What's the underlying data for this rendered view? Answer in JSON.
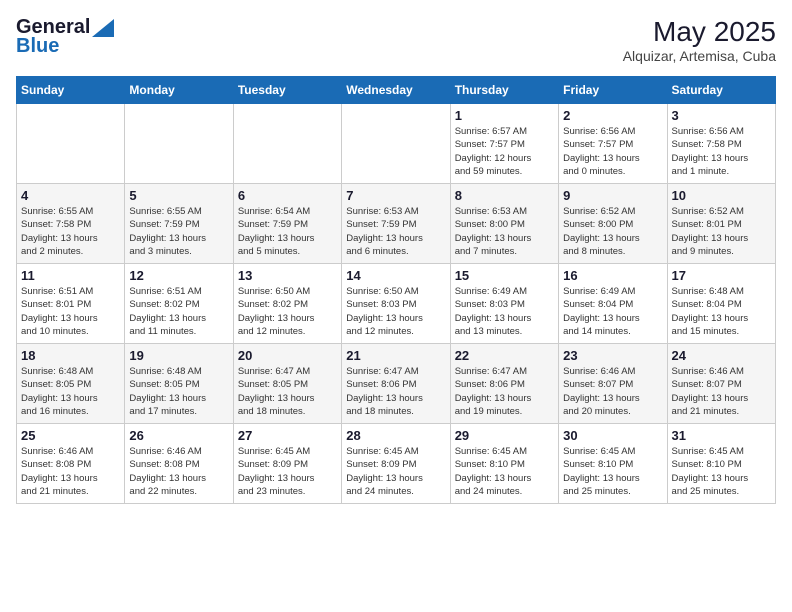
{
  "logo": {
    "general": "General",
    "blue": "Blue"
  },
  "title": "May 2025",
  "subtitle": "Alquizar, Artemisa, Cuba",
  "weekdays": [
    "Sunday",
    "Monday",
    "Tuesday",
    "Wednesday",
    "Thursday",
    "Friday",
    "Saturday"
  ],
  "days": [
    {
      "date": null,
      "number": "",
      "sunrise": "",
      "sunset": "",
      "daylight": ""
    },
    {
      "date": null,
      "number": "",
      "sunrise": "",
      "sunset": "",
      "daylight": ""
    },
    {
      "date": null,
      "number": "",
      "sunrise": "",
      "sunset": "",
      "daylight": ""
    },
    {
      "date": null,
      "number": "",
      "sunrise": "",
      "sunset": "",
      "daylight": ""
    },
    {
      "date": "1",
      "number": "1",
      "sunrise": "6:57 AM",
      "sunset": "7:57 PM",
      "daylight": "12 hours and 59 minutes."
    },
    {
      "date": "2",
      "number": "2",
      "sunrise": "6:56 AM",
      "sunset": "7:57 PM",
      "daylight": "13 hours and 0 minutes."
    },
    {
      "date": "3",
      "number": "3",
      "sunrise": "6:56 AM",
      "sunset": "7:58 PM",
      "daylight": "13 hours and 1 minute."
    },
    {
      "date": "4",
      "number": "4",
      "sunrise": "6:55 AM",
      "sunset": "7:58 PM",
      "daylight": "13 hours and 2 minutes."
    },
    {
      "date": "5",
      "number": "5",
      "sunrise": "6:55 AM",
      "sunset": "7:59 PM",
      "daylight": "13 hours and 3 minutes."
    },
    {
      "date": "6",
      "number": "6",
      "sunrise": "6:54 AM",
      "sunset": "7:59 PM",
      "daylight": "13 hours and 5 minutes."
    },
    {
      "date": "7",
      "number": "7",
      "sunrise": "6:53 AM",
      "sunset": "7:59 PM",
      "daylight": "13 hours and 6 minutes."
    },
    {
      "date": "8",
      "number": "8",
      "sunrise": "6:53 AM",
      "sunset": "8:00 PM",
      "daylight": "13 hours and 7 minutes."
    },
    {
      "date": "9",
      "number": "9",
      "sunrise": "6:52 AM",
      "sunset": "8:00 PM",
      "daylight": "13 hours and 8 minutes."
    },
    {
      "date": "10",
      "number": "10",
      "sunrise": "6:52 AM",
      "sunset": "8:01 PM",
      "daylight": "13 hours and 9 minutes."
    },
    {
      "date": "11",
      "number": "11",
      "sunrise": "6:51 AM",
      "sunset": "8:01 PM",
      "daylight": "13 hours and 10 minutes."
    },
    {
      "date": "12",
      "number": "12",
      "sunrise": "6:51 AM",
      "sunset": "8:02 PM",
      "daylight": "13 hours and 11 minutes."
    },
    {
      "date": "13",
      "number": "13",
      "sunrise": "6:50 AM",
      "sunset": "8:02 PM",
      "daylight": "13 hours and 12 minutes."
    },
    {
      "date": "14",
      "number": "14",
      "sunrise": "6:50 AM",
      "sunset": "8:03 PM",
      "daylight": "13 hours and 12 minutes."
    },
    {
      "date": "15",
      "number": "15",
      "sunrise": "6:49 AM",
      "sunset": "8:03 PM",
      "daylight": "13 hours and 13 minutes."
    },
    {
      "date": "16",
      "number": "16",
      "sunrise": "6:49 AM",
      "sunset": "8:04 PM",
      "daylight": "13 hours and 14 minutes."
    },
    {
      "date": "17",
      "number": "17",
      "sunrise": "6:48 AM",
      "sunset": "8:04 PM",
      "daylight": "13 hours and 15 minutes."
    },
    {
      "date": "18",
      "number": "18",
      "sunrise": "6:48 AM",
      "sunset": "8:05 PM",
      "daylight": "13 hours and 16 minutes."
    },
    {
      "date": "19",
      "number": "19",
      "sunrise": "6:48 AM",
      "sunset": "8:05 PM",
      "daylight": "13 hours and 17 minutes."
    },
    {
      "date": "20",
      "number": "20",
      "sunrise": "6:47 AM",
      "sunset": "8:05 PM",
      "daylight": "13 hours and 18 minutes."
    },
    {
      "date": "21",
      "number": "21",
      "sunrise": "6:47 AM",
      "sunset": "8:06 PM",
      "daylight": "13 hours and 18 minutes."
    },
    {
      "date": "22",
      "number": "22",
      "sunrise": "6:47 AM",
      "sunset": "8:06 PM",
      "daylight": "13 hours and 19 minutes."
    },
    {
      "date": "23",
      "number": "23",
      "sunrise": "6:46 AM",
      "sunset": "8:07 PM",
      "daylight": "13 hours and 20 minutes."
    },
    {
      "date": "24",
      "number": "24",
      "sunrise": "6:46 AM",
      "sunset": "8:07 PM",
      "daylight": "13 hours and 21 minutes."
    },
    {
      "date": "25",
      "number": "25",
      "sunrise": "6:46 AM",
      "sunset": "8:08 PM",
      "daylight": "13 hours and 21 minutes."
    },
    {
      "date": "26",
      "number": "26",
      "sunrise": "6:46 AM",
      "sunset": "8:08 PM",
      "daylight": "13 hours and 22 minutes."
    },
    {
      "date": "27",
      "number": "27",
      "sunrise": "6:45 AM",
      "sunset": "8:09 PM",
      "daylight": "13 hours and 23 minutes."
    },
    {
      "date": "28",
      "number": "28",
      "sunrise": "6:45 AM",
      "sunset": "8:09 PM",
      "daylight": "13 hours and 24 minutes."
    },
    {
      "date": "29",
      "number": "29",
      "sunrise": "6:45 AM",
      "sunset": "8:10 PM",
      "daylight": "13 hours and 24 minutes."
    },
    {
      "date": "30",
      "number": "30",
      "sunrise": "6:45 AM",
      "sunset": "8:10 PM",
      "daylight": "13 hours and 25 minutes."
    },
    {
      "date": "31",
      "number": "31",
      "sunrise": "6:45 AM",
      "sunset": "8:10 PM",
      "daylight": "13 hours and 25 minutes."
    }
  ]
}
